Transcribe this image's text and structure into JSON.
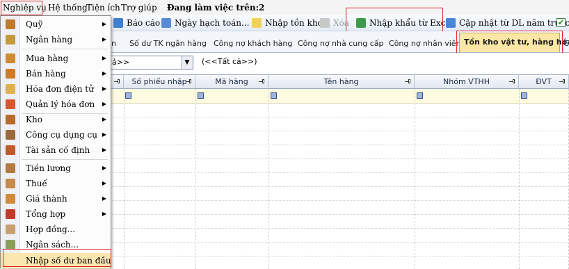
{
  "menubar": {
    "items": [
      "Nghiệp vụ",
      "Hệ thống",
      "Tiện ích",
      "Trợ giúp"
    ],
    "workday_label": "Đang làm việc trên:",
    "workday_value": "2"
  },
  "toolbar": {
    "report": "Báo cáo",
    "posting_date": "Ngày hạch toán...",
    "import_stock": "Nhập tồn kho",
    "delete": "Xóa",
    "import_excel": "Nhập khẩu từ Excel",
    "update_prev_year": "Cập nhật từ DL năm trước"
  },
  "tabs": [
    {
      "label": "n",
      "active": false
    },
    {
      "label": "Số dư TK ngân hàng",
      "active": false
    },
    {
      "label": "Công nợ khách hàng",
      "active": false
    },
    {
      "label": "Công nợ nhà cung cấp",
      "active": false
    },
    {
      "label": "Công nợ nhân viên",
      "active": false
    },
    {
      "label": "Tồn kho vật tư, hàng hóa",
      "active": true
    },
    {
      "label": "C",
      "active": false
    }
  ],
  "filter": {
    "selected": "cả>>",
    "all_label": "(<<Tất cả>>)"
  },
  "grid": {
    "columns": [
      "",
      "Số phiếu nhập",
      "Mã hàng",
      "Tên hàng",
      "Nhóm VTHH",
      "ĐVT"
    ]
  },
  "menu": {
    "items": [
      {
        "label": "Quỹ",
        "icon": "cash-box-icon",
        "submenu": true
      },
      {
        "label": "Ngân hàng",
        "icon": "bank-icon",
        "submenu": true
      },
      {
        "label": "Mua hàng",
        "icon": "purchase-icon",
        "submenu": true
      },
      {
        "label": "Bán hàng",
        "icon": "sales-icon",
        "submenu": true
      },
      {
        "label": "Hóa đơn điện tử",
        "icon": "e-invoice-icon",
        "submenu": true
      },
      {
        "label": "Quản lý hóa đơn",
        "icon": "invoice-management-icon",
        "submenu": true
      },
      {
        "label": "Kho",
        "icon": "warehouse-icon",
        "submenu": true
      },
      {
        "label": "Công cụ dụng cụ",
        "icon": "tools-icon",
        "submenu": true
      },
      {
        "label": "Tài sản cố định",
        "icon": "fixed-assets-icon",
        "submenu": true
      },
      {
        "label": "Tiền lương",
        "icon": "salary-icon",
        "submenu": true
      },
      {
        "label": "Thuế",
        "icon": "tax-icon",
        "submenu": true
      },
      {
        "label": "Giá thành",
        "icon": "cost-price-icon",
        "submenu": true
      },
      {
        "label": "Tổng hợp",
        "icon": "summary-book-icon",
        "submenu": true
      },
      {
        "label": "Hợp đồng...",
        "icon": "contract-icon",
        "submenu": false
      },
      {
        "label": "Ngân sách...",
        "icon": "budget-icon",
        "submenu": false
      },
      {
        "label": "Nhập số dư ban đầu",
        "icon": "opening-balance-icon",
        "submenu": false
      }
    ]
  },
  "colors": {
    "highlight_box": "#e0202a",
    "active_tab_bg": "#fde7a6",
    "filter_row_bg": "#fffbe0"
  }
}
